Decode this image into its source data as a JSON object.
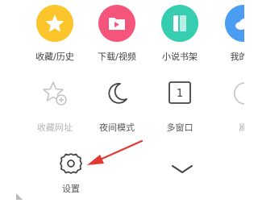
{
  "colors": {
    "favorites_bg": "#fcc52b",
    "downloads_bg": "#f5557a",
    "novels_bg": "#37cdb1",
    "mine_bg": "#4a9df1",
    "annotation_arrow": "#e03a32",
    "icon_muted": "#c4c4c4",
    "icon_dark": "#444444"
  },
  "menu": {
    "row1": [
      {
        "label": "收藏/历史",
        "icon": "star-icon"
      },
      {
        "label": "下载/视频",
        "icon": "folder-play-icon"
      },
      {
        "label": "小说书架",
        "icon": "book-icon"
      },
      {
        "label": "我的白",
        "icon": "cloud-icon"
      }
    ],
    "row2": [
      {
        "label": "收藏网址",
        "icon": "star-add-icon"
      },
      {
        "label": "夜间模式",
        "icon": "moon-icon"
      },
      {
        "label": "多窗口",
        "icon": "window-count-icon",
        "count": "1"
      },
      {
        "label": "刷",
        "icon": "refresh-icon"
      }
    ],
    "row3": [
      {
        "label": "设置",
        "icon": "gear-icon"
      }
    ],
    "collapse_icon": "chevron-down-icon"
  }
}
